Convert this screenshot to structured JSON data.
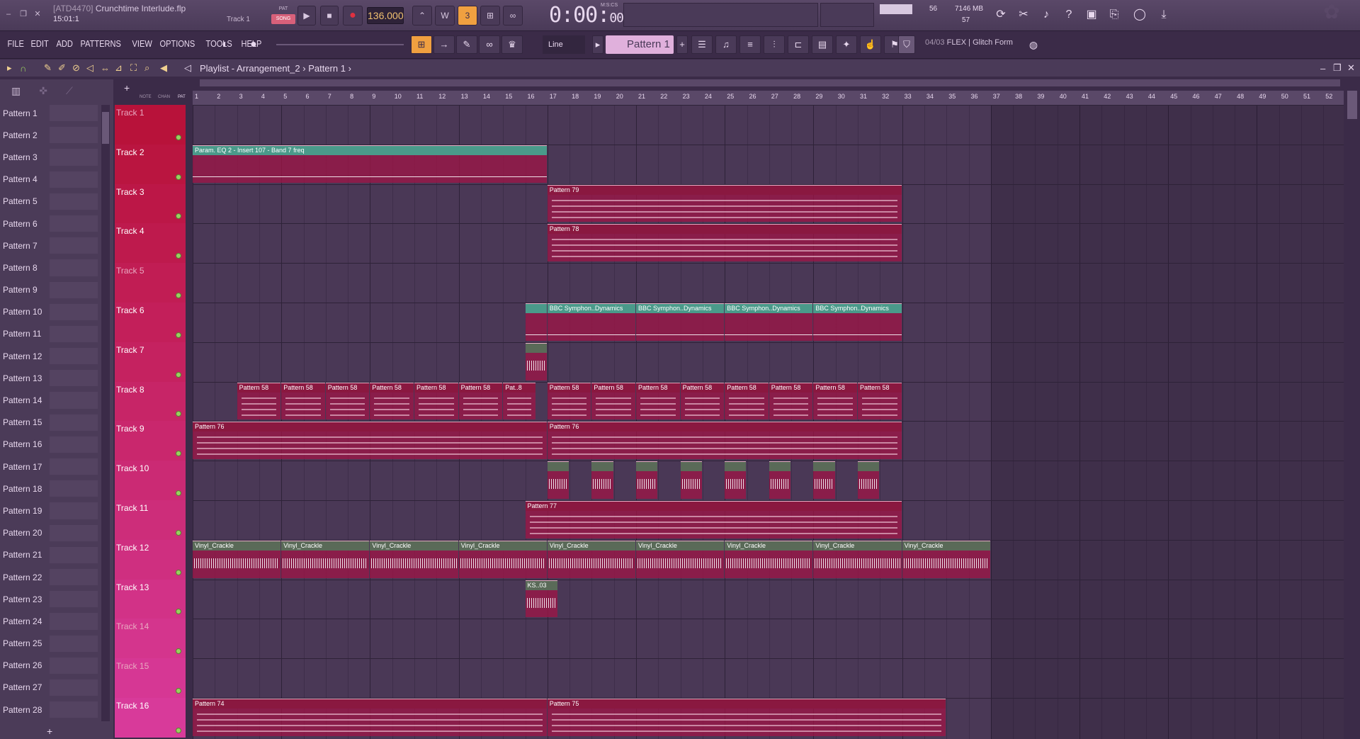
{
  "window": {
    "tag": "[ATD4470]",
    "file": "Crunchtime Interlude.flp",
    "position": "15:01:1",
    "track_hint": "Track 1"
  },
  "transport": {
    "pat_label": "PAT",
    "song_label": "SONG",
    "bpm": "136.000",
    "time_main": "0:00",
    "time_sub": "00",
    "time_unit": "M:S:CS"
  },
  "cpu": {
    "value": "56",
    "memory": "7146 MB",
    "polyphony": "57"
  },
  "menu": [
    "FILE",
    "EDIT",
    "ADD",
    "PATTERNS",
    "VIEW",
    "OPTIONS",
    "TOOLS",
    "HELP"
  ],
  "toolbar": {
    "snap": "Line",
    "pattern": "Pattern 1",
    "news": "04/03",
    "news_text": "FLEX | Glitch Form"
  },
  "playlist": {
    "title": "Playlist - Arrangement_2",
    "crumb": "Pattern 1",
    "header_cols": [
      "NOTE",
      "CHAN",
      "PAT"
    ]
  },
  "patterns": [
    "Pattern 1",
    "Pattern 2",
    "Pattern 3",
    "Pattern 4",
    "Pattern 5",
    "Pattern 6",
    "Pattern 7",
    "Pattern 8",
    "Pattern 9",
    "Pattern 10",
    "Pattern 11",
    "Pattern 12",
    "Pattern 13",
    "Pattern 14",
    "Pattern 15",
    "Pattern 16",
    "Pattern 17",
    "Pattern 18",
    "Pattern 19",
    "Pattern 20",
    "Pattern 21",
    "Pattern 22",
    "Pattern 23",
    "Pattern 24",
    "Pattern 25",
    "Pattern 26",
    "Pattern 27",
    "Pattern 28"
  ],
  "tracks": [
    "Track 1",
    "Track 2",
    "Track 3",
    "Track 4",
    "Track 5",
    "Track 6",
    "Track 7",
    "Track 8",
    "Track 9",
    "Track 10",
    "Track 11",
    "Track 12",
    "Track 13",
    "Track 14",
    "Track 15",
    "Track 16"
  ],
  "dim_tracks": [
    1,
    5,
    14,
    15
  ],
  "bars": [
    1,
    2,
    3,
    4,
    5,
    6,
    7,
    8,
    9,
    10,
    11,
    12,
    13,
    14,
    15,
    16,
    17,
    18,
    19,
    20,
    21,
    22,
    23,
    24,
    25,
    26,
    27,
    28,
    29,
    30,
    31,
    32,
    33,
    34,
    35,
    36,
    37,
    38,
    39,
    40,
    41,
    42,
    43,
    44,
    45,
    46,
    47,
    48,
    49,
    50,
    51,
    52
  ],
  "clips": [
    {
      "track": 2,
      "start": 1,
      "len": 16,
      "label": "Param. EQ 2 - Insert 107 - Band 7 freq",
      "kind": "auto"
    },
    {
      "track": 3,
      "start": 17,
      "len": 16,
      "label": "Pattern 79",
      "kind": "pat"
    },
    {
      "track": 4,
      "start": 17,
      "len": 16,
      "label": "Pattern 78",
      "kind": "pat"
    },
    {
      "track": 6,
      "start": 16,
      "len": 1,
      "label": "",
      "kind": "auto"
    },
    {
      "track": 6,
      "start": 17,
      "len": 4,
      "label": "BBC Symphon..Dynamics",
      "kind": "auto"
    },
    {
      "track": 6,
      "start": 21,
      "len": 4,
      "label": "BBC Symphon..Dynamics",
      "kind": "auto"
    },
    {
      "track": 6,
      "start": 25,
      "len": 4,
      "label": "BBC Symphon..Dynamics",
      "kind": "auto"
    },
    {
      "track": 6,
      "start": 29,
      "len": 4,
      "label": "BBC Symphon..Dynamics",
      "kind": "auto"
    },
    {
      "track": 7,
      "start": 16,
      "len": 1,
      "label": "",
      "kind": "audio"
    },
    {
      "track": 8,
      "start": 3,
      "len": 2,
      "label": "Pattern 58",
      "kind": "pat"
    },
    {
      "track": 8,
      "start": 5,
      "len": 2,
      "label": "Pattern 58",
      "kind": "pat"
    },
    {
      "track": 8,
      "start": 7,
      "len": 2,
      "label": "Pattern 58",
      "kind": "pat"
    },
    {
      "track": 8,
      "start": 9,
      "len": 2,
      "label": "Pattern 58",
      "kind": "pat"
    },
    {
      "track": 8,
      "start": 11,
      "len": 2,
      "label": "Pattern 58",
      "kind": "pat"
    },
    {
      "track": 8,
      "start": 13,
      "len": 2,
      "label": "Pattern 58",
      "kind": "pat"
    },
    {
      "track": 8,
      "start": 15,
      "len": 1.5,
      "label": "Pat..8",
      "kind": "pat"
    },
    {
      "track": 8,
      "start": 17,
      "len": 2,
      "label": "Pattern 58",
      "kind": "pat"
    },
    {
      "track": 8,
      "start": 19,
      "len": 2,
      "label": "Pattern 58",
      "kind": "pat"
    },
    {
      "track": 8,
      "start": 21,
      "len": 2,
      "label": "Pattern 58",
      "kind": "pat"
    },
    {
      "track": 8,
      "start": 23,
      "len": 2,
      "label": "Pattern 58",
      "kind": "pat"
    },
    {
      "track": 8,
      "start": 25,
      "len": 2,
      "label": "Pattern 58",
      "kind": "pat"
    },
    {
      "track": 8,
      "start": 27,
      "len": 2,
      "label": "Pattern 58",
      "kind": "pat"
    },
    {
      "track": 8,
      "start": 29,
      "len": 2,
      "label": "Pattern 58",
      "kind": "pat"
    },
    {
      "track": 8,
      "start": 31,
      "len": 2,
      "label": "Pattern 58",
      "kind": "pat"
    },
    {
      "track": 9,
      "start": 1,
      "len": 16,
      "label": "Pattern 76",
      "kind": "pat"
    },
    {
      "track": 9,
      "start": 17,
      "len": 16,
      "label": "Pattern 76",
      "kind": "pat"
    },
    {
      "track": 10,
      "start": 17,
      "len": 1,
      "label": "",
      "kind": "audio"
    },
    {
      "track": 10,
      "start": 19,
      "len": 1,
      "label": "",
      "kind": "audio"
    },
    {
      "track": 10,
      "start": 21,
      "len": 1,
      "label": "",
      "kind": "audio"
    },
    {
      "track": 10,
      "start": 23,
      "len": 1,
      "label": "",
      "kind": "audio"
    },
    {
      "track": 10,
      "start": 25,
      "len": 1,
      "label": "",
      "kind": "audio"
    },
    {
      "track": 10,
      "start": 27,
      "len": 1,
      "label": "",
      "kind": "audio"
    },
    {
      "track": 10,
      "start": 29,
      "len": 1,
      "label": "",
      "kind": "audio"
    },
    {
      "track": 10,
      "start": 31,
      "len": 1,
      "label": "",
      "kind": "audio"
    },
    {
      "track": 11,
      "start": 16,
      "len": 17,
      "label": "Pattern 77",
      "kind": "pat"
    },
    {
      "track": 12,
      "start": 1,
      "len": 4,
      "label": "Vinyl_Crackle",
      "kind": "audio"
    },
    {
      "track": 12,
      "start": 5,
      "len": 4,
      "label": "Vinyl_Crackle",
      "kind": "audio"
    },
    {
      "track": 12,
      "start": 9,
      "len": 4,
      "label": "Vinyl_Crackle",
      "kind": "audio"
    },
    {
      "track": 12,
      "start": 13,
      "len": 4,
      "label": "Vinyl_Crackle",
      "kind": "audio"
    },
    {
      "track": 12,
      "start": 17,
      "len": 4,
      "label": "Vinyl_Crackle",
      "kind": "audio"
    },
    {
      "track": 12,
      "start": 21,
      "len": 4,
      "label": "Vinyl_Crackle",
      "kind": "audio"
    },
    {
      "track": 12,
      "start": 25,
      "len": 4,
      "label": "Vinyl_Crackle",
      "kind": "audio"
    },
    {
      "track": 12,
      "start": 29,
      "len": 4,
      "label": "Vinyl_Crackle",
      "kind": "audio"
    },
    {
      "track": 12,
      "start": 33,
      "len": 4,
      "label": "Vinyl_Crackle",
      "kind": "audio"
    },
    {
      "track": 13,
      "start": 16,
      "len": 1.5,
      "label": "KS..03",
      "kind": "audio"
    },
    {
      "track": 16,
      "start": 1,
      "len": 16,
      "label": "Pattern 74",
      "kind": "pat"
    },
    {
      "track": 16,
      "start": 17,
      "len": 18,
      "label": "Pattern 75",
      "kind": "pat"
    }
  ],
  "colors": {
    "track_top": "#b8123a",
    "track_bottom": "#d83a9a",
    "clip_pat": "#8a1840",
    "clip_auto": "#4a9a8a",
    "clip_audio": "#5a6a58"
  }
}
